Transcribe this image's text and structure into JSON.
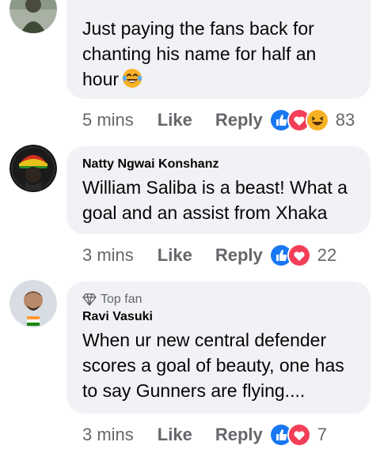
{
  "comments": [
    {
      "name": "",
      "text_lines": [
        "Just paying the fans back for",
        "chanting his name for half an",
        "hour"
      ],
      "text_emoji": "laughing-tears-emoji",
      "time": "5 mins",
      "like": "Like",
      "reply": "Reply",
      "reactions": [
        "like-reaction-icon",
        "love-reaction-icon",
        "haha-reaction-icon"
      ],
      "count": "83"
    },
    {
      "name": "Natty Ngwai Konshanz",
      "text_lines": [
        "William Saliba is a beast! What a",
        "goal and an assist from Xhaka"
      ],
      "time": "3 mins",
      "like": "Like",
      "reply": "Reply",
      "reactions": [
        "like-reaction-icon",
        "love-reaction-icon"
      ],
      "count": "22"
    },
    {
      "badge": "Top fan",
      "name": "Ravi Vasuki",
      "text_lines": [
        "When ur new central defender",
        "scores a goal of beauty, one has",
        "to say Gunners are flying...."
      ],
      "time": "3 mins",
      "like": "Like",
      "reply": "Reply",
      "reactions": [
        "like-reaction-icon",
        "love-reaction-icon"
      ],
      "count": "7"
    }
  ],
  "colors": {
    "bubble": "#f0f2f5",
    "meta_text": "#65676b",
    "like_blue": "#1877f2",
    "love_red": "#f33e58",
    "haha_yellow": "#f7b125"
  }
}
